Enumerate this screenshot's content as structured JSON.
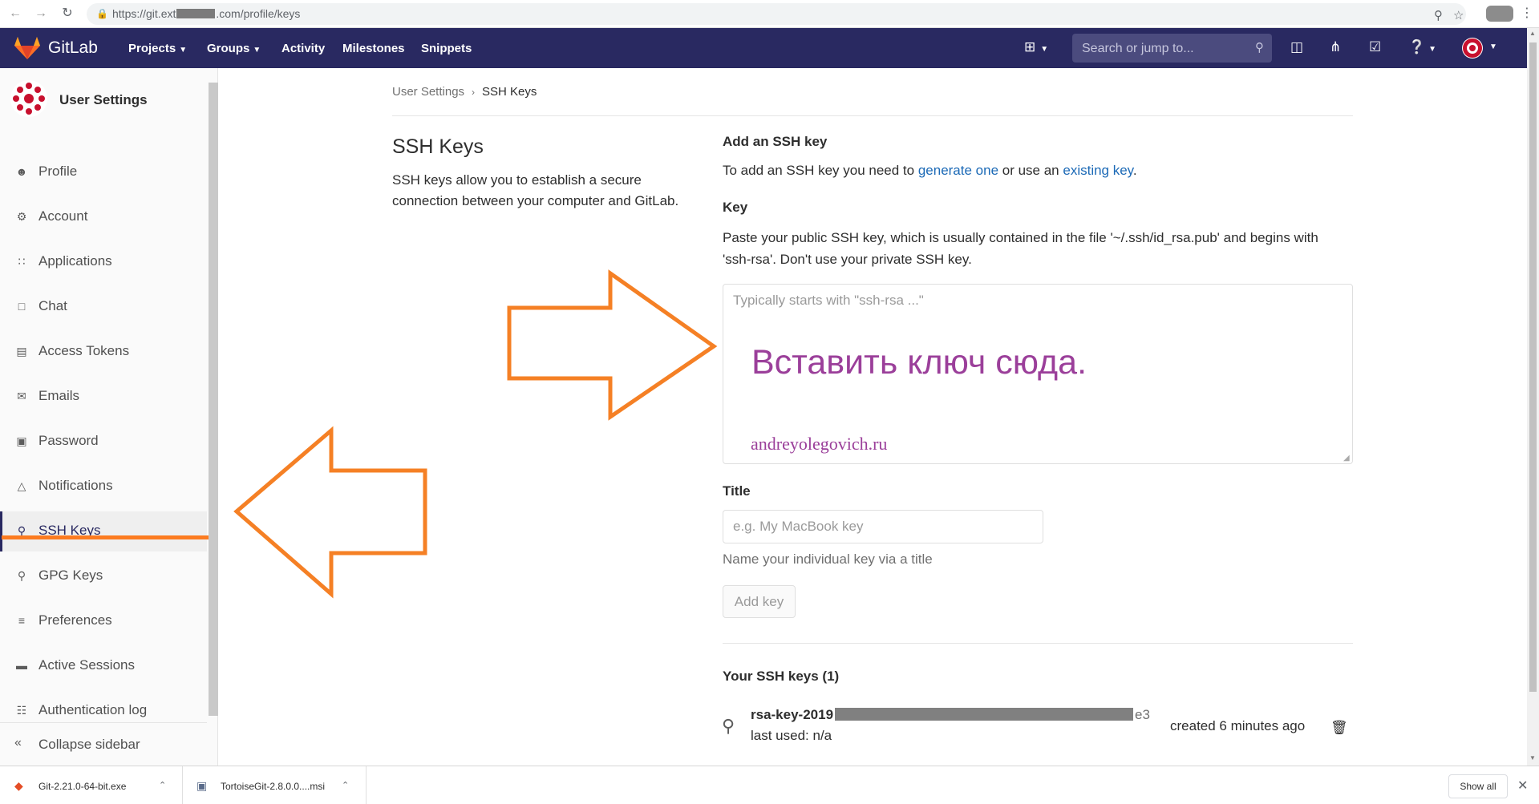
{
  "browser": {
    "url_prefix": "https://git.ext",
    "url_suffix": ".com/profile/keys",
    "back_icon": "arrow-left-icon",
    "forward_icon": "arrow-right-icon",
    "reload_icon": "reload-icon"
  },
  "header": {
    "brand": "GitLab",
    "nav": [
      {
        "label": "Projects",
        "has_dropdown": true
      },
      {
        "label": "Groups",
        "has_dropdown": true
      },
      {
        "label": "Activity",
        "has_dropdown": false
      },
      {
        "label": "Milestones",
        "has_dropdown": false
      },
      {
        "label": "Snippets",
        "has_dropdown": false
      }
    ],
    "search_placeholder": "Search or jump to...",
    "colors": {
      "header_bg": "#292961",
      "logo_orange": "#fc6d26"
    }
  },
  "sidebar": {
    "title": "User Settings",
    "items": [
      {
        "label": "Profile",
        "icon": "profile-icon",
        "active": false
      },
      {
        "label": "Account",
        "icon": "account-icon",
        "active": false
      },
      {
        "label": "Applications",
        "icon": "applications-icon",
        "active": false
      },
      {
        "label": "Chat",
        "icon": "chat-icon",
        "active": false
      },
      {
        "label": "Access Tokens",
        "icon": "token-icon",
        "active": false
      },
      {
        "label": "Emails",
        "icon": "email-icon",
        "active": false
      },
      {
        "label": "Password",
        "icon": "lock-icon",
        "active": false
      },
      {
        "label": "Notifications",
        "icon": "bell-icon",
        "active": false
      },
      {
        "label": "SSH Keys",
        "icon": "key-icon",
        "active": true
      },
      {
        "label": "GPG Keys",
        "icon": "key-icon",
        "active": false
      },
      {
        "label": "Preferences",
        "icon": "sliders-icon",
        "active": false
      },
      {
        "label": "Active Sessions",
        "icon": "monitor-icon",
        "active": false
      },
      {
        "label": "Authentication log",
        "icon": "log-icon",
        "active": false
      }
    ],
    "collapse_label": "Collapse sidebar"
  },
  "breadcrumb": {
    "parent": "User Settings",
    "separator": "›",
    "current": "SSH Keys"
  },
  "intro": {
    "heading": "SSH Keys",
    "description": "SSH keys allow you to establish a secure connection between your computer and GitLab."
  },
  "form": {
    "add_title": "Add an SSH key",
    "add_desc_before": "To add an SSH key you need to ",
    "generate_link": "generate one",
    "add_desc_middle": " or use an ",
    "existing_link": "existing key",
    "add_desc_after": ".",
    "key_label": "Key",
    "key_help": "Paste your public SSH key, which is usually contained in the file '~/.ssh/id_rsa.pub' and begins with 'ssh-rsa'. Don't use your private SSH key.",
    "key_placeholder": "Typically starts with \"ssh-rsa ...\"",
    "title_label": "Title",
    "title_placeholder": "e.g. My MacBook key",
    "title_help": "Name your individual key via a title",
    "add_button": "Add key"
  },
  "annotation": {
    "paste_here": "Вставить ключ сюда.",
    "site": "andreyolegovich.ru",
    "arrow_color": "#f58025"
  },
  "keys": {
    "heading": "Your SSH keys (1)",
    "list": [
      {
        "name_prefix": "rsa-key-2019",
        "name_suffix": "e3",
        "last_used": "last used: n/a",
        "created": "created 6 minutes ago"
      }
    ]
  },
  "downloads": {
    "items": [
      {
        "name": "Git-2.21.0-64-bit.exe"
      },
      {
        "name": "TortoiseGit-2.8.0.0....msi"
      }
    ],
    "show_all": "Show all"
  }
}
